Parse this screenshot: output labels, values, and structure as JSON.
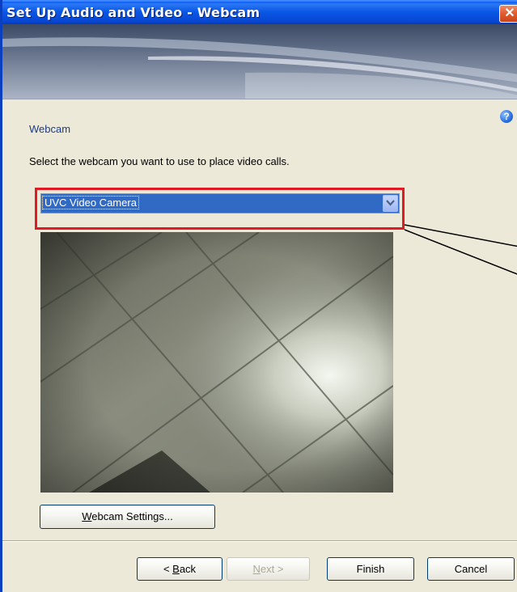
{
  "window": {
    "title": "Set Up Audio and Video - Webcam",
    "close_glyph": "✕"
  },
  "content": {
    "section_title": "Webcam",
    "instructions": "Select the webcam you want to use to place video calls.",
    "help_glyph": "?"
  },
  "webcam_select": {
    "selected": "UVC Video Camera"
  },
  "buttons": {
    "webcam_settings": {
      "pre": "",
      "accel": "W",
      "post": "ebcam Settings..."
    },
    "back": {
      "pre": "< ",
      "accel": "B",
      "post": "ack"
    },
    "next": {
      "pre": "",
      "accel": "N",
      "post": "ext >"
    },
    "finish": "Finish",
    "cancel": "Cancel"
  },
  "colors": {
    "titlebar": "#0a57e6",
    "dialog_bg": "#ece9d8",
    "selection": "#316ac5",
    "callout_highlight": "#e01b24"
  },
  "icons": [
    "close-icon",
    "help-icon",
    "chevron-down-icon"
  ]
}
